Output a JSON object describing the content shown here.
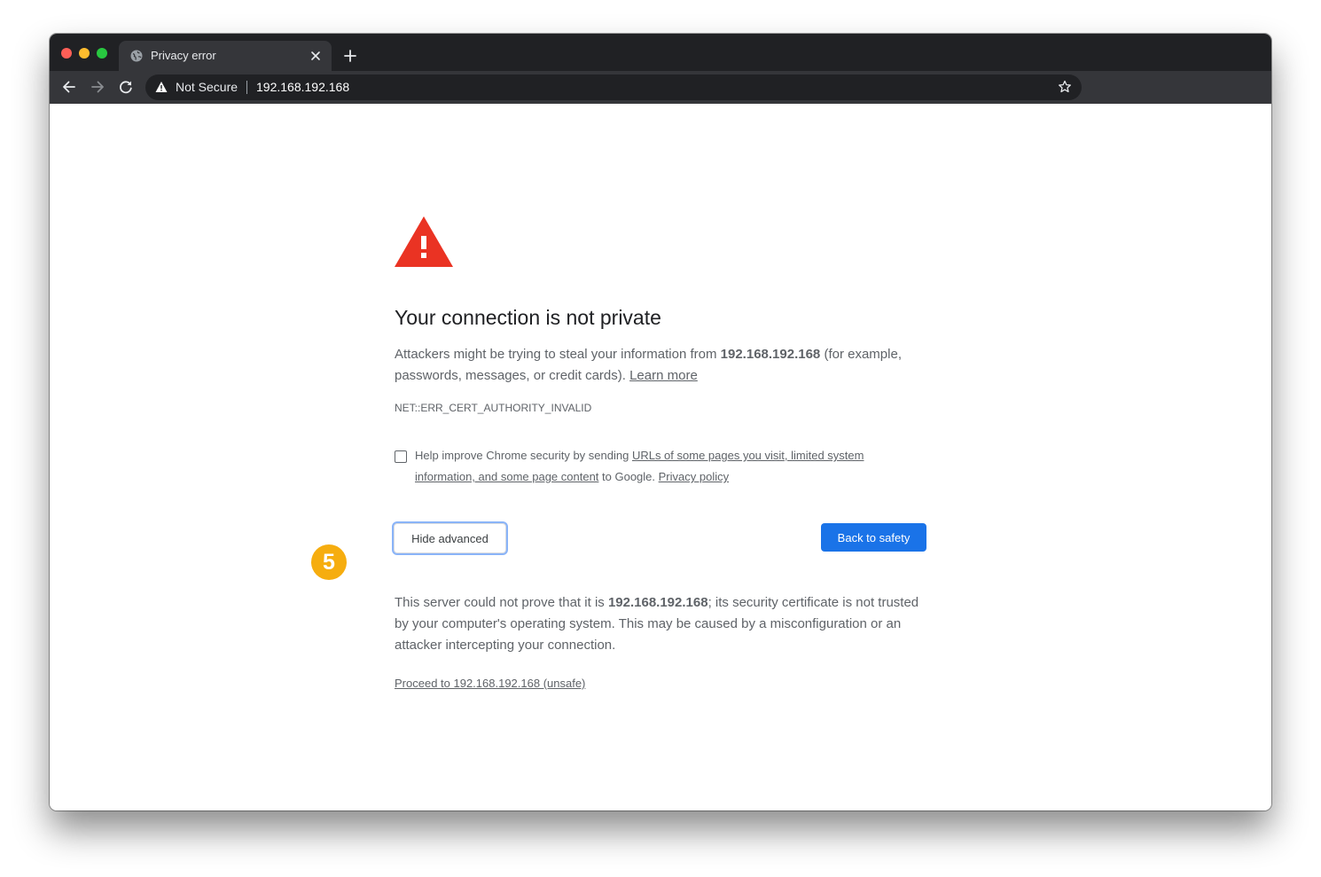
{
  "browser": {
    "tab_title": "Privacy error",
    "security_label": "Not Secure",
    "url": "192.168.192.168"
  },
  "page": {
    "heading": "Your connection is not private",
    "intro_prefix": "Attackers might be trying to steal your information from ",
    "host": "192.168.192.168",
    "intro_suffix": " (for example, passwords, messages, or credit cards). ",
    "learn_more": "Learn more",
    "error_code": "NET::ERR_CERT_AUTHORITY_INVALID",
    "optin_prefix": "Help improve Chrome security by sending ",
    "optin_link": "URLs of some pages you visit, limited system information, and some page content",
    "optin_middle": " to Google. ",
    "privacy_policy": "Privacy policy",
    "hide_advanced": "Hide advanced",
    "back_to_safety": "Back to safety",
    "details_prefix": "This server could not prove that it is ",
    "details_suffix": "; its security certificate is not trusted by your computer's operating system. This may be caused by a misconfiguration or an attacker intercepting your connection.",
    "proceed_link": "Proceed to 192.168.192.168 (unsafe)"
  },
  "annotation": {
    "step_number": "5",
    "color": "#f6ad0f"
  },
  "colors": {
    "accent": "#1a73e8",
    "warning": "#ea3323",
    "text": "#5f6368"
  }
}
